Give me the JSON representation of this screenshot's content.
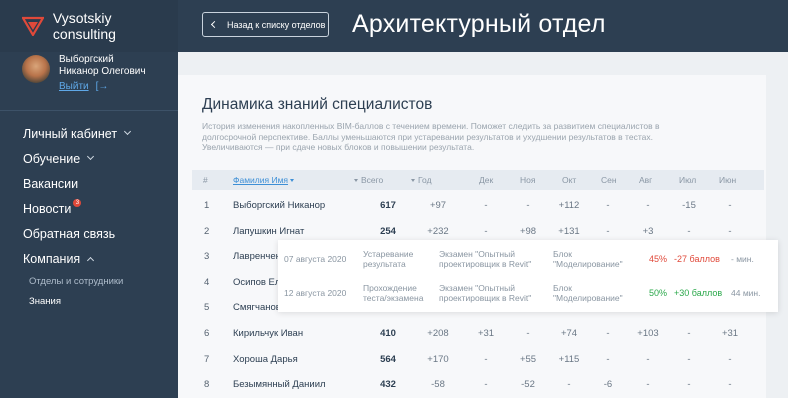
{
  "brand": {
    "name": "Vysotskiy consulting",
    "logo_color": "#e0493a"
  },
  "user": {
    "name_line1": "Выборгский",
    "name_line2": "Никанор Олегович",
    "logout": "Выйти"
  },
  "nav": {
    "items": [
      {
        "label": "Личный кабинет"
      },
      {
        "label": "Обучение"
      },
      {
        "label": "Вакансии"
      },
      {
        "label": "Новости",
        "badge": "3"
      },
      {
        "label": "Обратная связь"
      },
      {
        "label": "Компания"
      }
    ],
    "sub_items": [
      {
        "label": "Отделы и сотрудники"
      },
      {
        "label": "Знания"
      }
    ]
  },
  "header": {
    "back_label": "Назад к списку отделов",
    "title": "Архитектурный отдел"
  },
  "card": {
    "title": "Динамика знаний специалистов",
    "description": "История изменения накопленных BIM-баллов с течением времени. Поможет следить за развитием специалистов в долгосрочной перспективе. Баллы уменьшаются при устаревании результатов и ухудшении результатов в тестах. Увеличиваются — при сдаче новых блоков и повышении результата."
  },
  "table": {
    "headers": {
      "idx": "#",
      "name": "Фамилия Имя",
      "total": "Всего",
      "year": "Год",
      "dec": "Дек",
      "nov": "Ноя",
      "oct": "Окт",
      "sep": "Сен",
      "aug": "Авг",
      "jul": "Июл",
      "jun": "Июн"
    },
    "rows": [
      {
        "idx": "1",
        "name": "Выборгский Никанор",
        "total": "617",
        "year": "+97",
        "dec": "-",
        "nov": "-",
        "oct": "+112",
        "sep": "-",
        "aug": "-",
        "jul": "-15",
        "jun": "-"
      },
      {
        "idx": "2",
        "name": "Лапушкин Игнат",
        "total": "254",
        "year": "+232",
        "dec": "-",
        "nov": "+98",
        "oct": "+131",
        "sep": "-",
        "aug": "+3",
        "jul": "-",
        "jun": "-"
      },
      {
        "idx": "3",
        "name": "Лавренченко Н",
        "total": "",
        "year": "",
        "dec": "",
        "nov": "",
        "oct": "",
        "sep": "",
        "aug": "",
        "jul": "",
        "jun": ""
      },
      {
        "idx": "4",
        "name": "Осипов Елисей",
        "total": "",
        "year": "",
        "dec": "",
        "nov": "",
        "oct": "",
        "sep": "",
        "aug": "",
        "jul": "",
        "jun": ""
      },
      {
        "idx": "5",
        "name": "Смягчанова Л",
        "total": "",
        "year": "",
        "dec": "",
        "nov": "",
        "oct": "",
        "sep": "",
        "aug": "",
        "jul": "",
        "jun": ""
      },
      {
        "idx": "6",
        "name": "Кирильчук Иван",
        "total": "410",
        "year": "+208",
        "dec": "+31",
        "nov": "-",
        "oct": "+74",
        "sep": "-",
        "aug": "+103",
        "jul": "-",
        "jun": "+31"
      },
      {
        "idx": "7",
        "name": "Хороша Дарья",
        "total": "564",
        "year": "+170",
        "dec": "-",
        "nov": "+55",
        "oct": "+115",
        "sep": "-",
        "aug": "-",
        "jul": "-",
        "jun": "-"
      },
      {
        "idx": "8",
        "name": "Безымянный Даниил",
        "total": "432",
        "year": "-58",
        "dec": "-",
        "nov": "-52",
        "oct": "-",
        "sep": "-6",
        "aug": "-",
        "jul": "-",
        "jun": "-"
      }
    ]
  },
  "popup": {
    "rows": [
      {
        "date": "07 августа 2020",
        "type_line1": "Устаревание",
        "type_line2": "результата",
        "exam_line1": "Экзамен \"Опытный",
        "exam_line2": "проектировщик в Revit\"",
        "block_line1": "Блок",
        "block_line2": "\"Моделирование\"",
        "percent": "45%",
        "points": "-27 баллов",
        "time": "- мин."
      },
      {
        "date": "12 августа 2020",
        "type_line1": "Прохождение",
        "type_line2": "теста/экзамена",
        "exam_line1": "Экзамен \"Опытный",
        "exam_line2": "проектировщик в Revit\"",
        "block_line1": "Блок",
        "block_line2": "\"Моделирование\"",
        "percent": "50%",
        "points": "+30 баллов",
        "time": "44 мин."
      }
    ]
  }
}
